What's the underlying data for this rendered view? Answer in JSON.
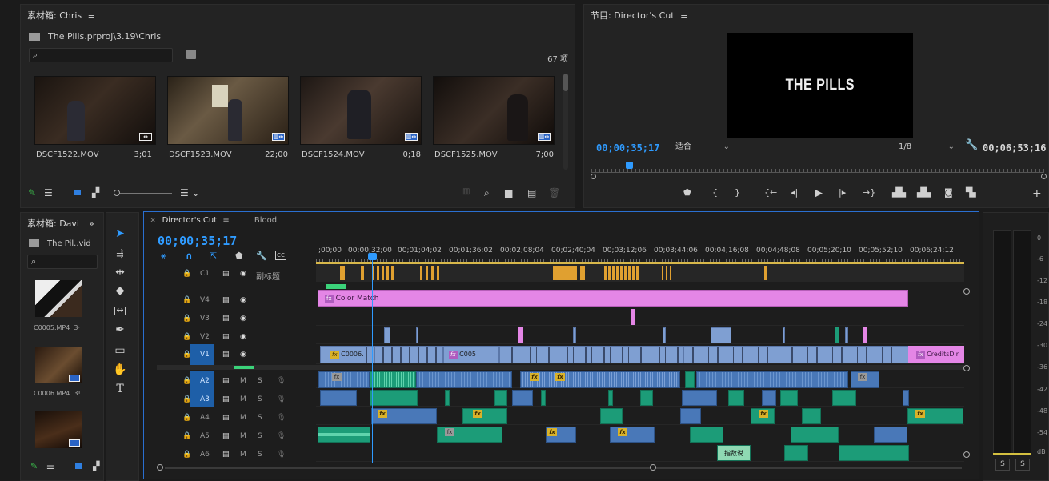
{
  "colors": {
    "accent": "#2f9bff",
    "timeline_border": "#2a6fd1",
    "color_match_clip": "#e486e6",
    "video_clip": "#7f9fd2",
    "audio_clip": "#4978b8",
    "audio_clip_green": "#1c9c78",
    "marker": "#f0b030",
    "fx_badge": "#d9b22a"
  },
  "bin_top": {
    "title": "素材箱: Chris",
    "path": "The Pills.prproj\\3.19\\Chris",
    "search_placeholder": "",
    "item_count": "67 项",
    "clips": [
      {
        "name": "DSCF1522.MOV",
        "duration": "3;01"
      },
      {
        "name": "DSCF1523.MOV",
        "duration": "22;00"
      },
      {
        "name": "DSCF1524.MOV",
        "duration": "0;18"
      },
      {
        "name": "DSCF1525.MOV",
        "duration": "7;00"
      }
    ]
  },
  "program": {
    "title": "节目: Director's Cut",
    "frame_text": "THE PILLS",
    "timecode": "00;00;35;17",
    "fit_label": "适合",
    "resolution": "1/8",
    "duration": "00;06;53;16"
  },
  "bin_left": {
    "title": "素材箱: Davi",
    "path": "The Pil..vid",
    "clips": [
      {
        "name": "C0005.MP4",
        "duration": "3·"
      },
      {
        "name": "C0006.MP4",
        "duration": "3!"
      }
    ]
  },
  "timeline": {
    "tabs": [
      "Director's Cut",
      "Blood"
    ],
    "timecode": "00;00;35;17",
    "caption_track": {
      "label": "C1",
      "name": "副标题"
    },
    "video_tracks": [
      "V4",
      "V3",
      "V2",
      "V1"
    ],
    "audio_tracks": [
      "A2",
      "A3",
      "A4",
      "A5",
      "A6"
    ],
    "audio_buttons": {
      "mute": "M",
      "solo": "S"
    },
    "ruler": [
      ";00;00",
      "00;00;32;00",
      "00;01;04;02",
      "00;01;36;02",
      "00;02;08;04",
      "00;02;40;04",
      "00;03;12;06",
      "00;03;44;06",
      "00;04;16;08",
      "00;04;48;08",
      "00;05;20;10",
      "00;05;52;10",
      "00;06;24;12"
    ],
    "clip_labels": {
      "color_match": "Color Match",
      "c0006": "C0006.",
      "c005": "C005",
      "credits": "CreditsDir",
      "subtitle_clip": "指数说"
    }
  },
  "meters": {
    "scale": [
      "0",
      "-6",
      "-12",
      "-18",
      "-24",
      "-30",
      "-36",
      "-42",
      "-48",
      "-54",
      "dB"
    ],
    "solo_buttons": [
      "S",
      "S"
    ]
  }
}
